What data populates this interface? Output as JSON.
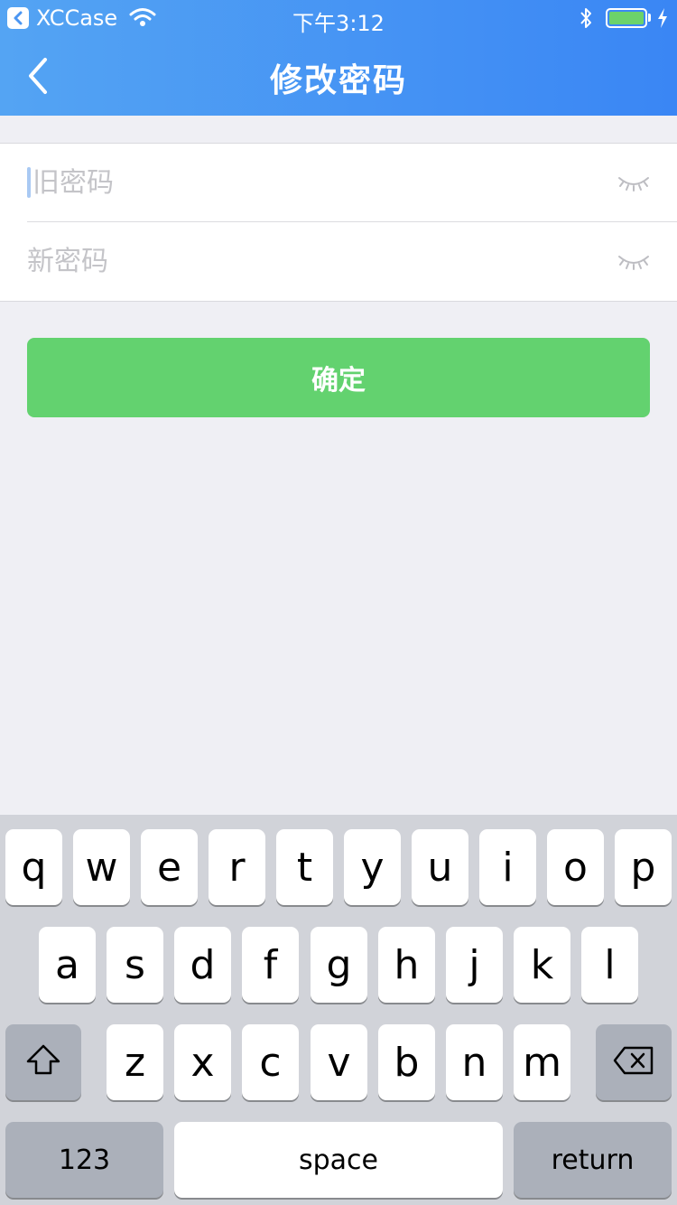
{
  "status_bar": {
    "carrier": "XCCase",
    "time": "下午3:12"
  },
  "nav": {
    "title": "修改密码"
  },
  "form": {
    "old_password_placeholder": "旧密码",
    "new_password_placeholder": "新密码"
  },
  "confirm_label": "确定",
  "keyboard": {
    "row1": [
      "q",
      "w",
      "e",
      "r",
      "t",
      "y",
      "u",
      "i",
      "o",
      "p"
    ],
    "row2": [
      "a",
      "s",
      "d",
      "f",
      "g",
      "h",
      "j",
      "k",
      "l"
    ],
    "row3": [
      "z",
      "x",
      "c",
      "v",
      "b",
      "n",
      "m"
    ],
    "numbers_label": "123",
    "space_label": "space",
    "return_label": "return"
  },
  "colors": {
    "header_start": "#54a4f3",
    "header_end": "#3a86f4",
    "confirm_green": "#63d26f",
    "battery_green": "#6cd36a"
  },
  "icons": [
    "back-to-app-icon",
    "wifi-icon",
    "bluetooth-icon",
    "battery-icon",
    "charging-icon",
    "back-chevron-icon",
    "eye-closed-icon",
    "shift-icon",
    "delete-icon"
  ]
}
